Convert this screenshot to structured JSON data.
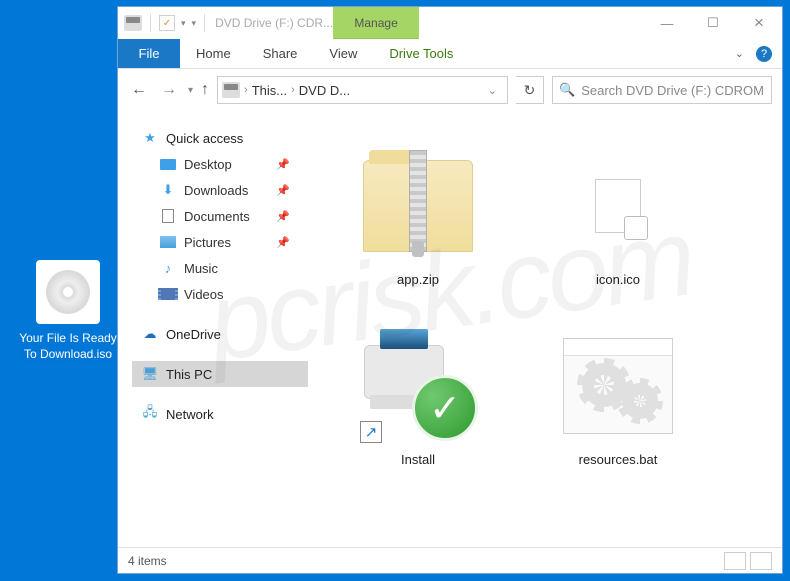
{
  "desktop": {
    "icon_label": "Your File Is Ready To Download.iso"
  },
  "titlebar": {
    "title": "DVD Drive (F:) CDR...",
    "manage": "Manage"
  },
  "ribbon": {
    "file": "File",
    "tabs": [
      "Home",
      "Share",
      "View"
    ],
    "drive_tools": "Drive Tools"
  },
  "breadcrumb": {
    "seg1": "This...",
    "seg2": "DVD D..."
  },
  "search": {
    "placeholder": "Search DVD Drive (F:) CDROM"
  },
  "sidebar": {
    "quick_access": "Quick access",
    "desktop": "Desktop",
    "downloads": "Downloads",
    "documents": "Documents",
    "pictures": "Pictures",
    "music": "Music",
    "videos": "Videos",
    "onedrive": "OneDrive",
    "this_pc": "This PC",
    "network": "Network"
  },
  "files": {
    "app_zip": "app.zip",
    "icon_ico": "icon.ico",
    "install": "Install",
    "resources_bat": "resources.bat"
  },
  "status": {
    "count": "4 items"
  },
  "watermark": "pcrisk.com"
}
